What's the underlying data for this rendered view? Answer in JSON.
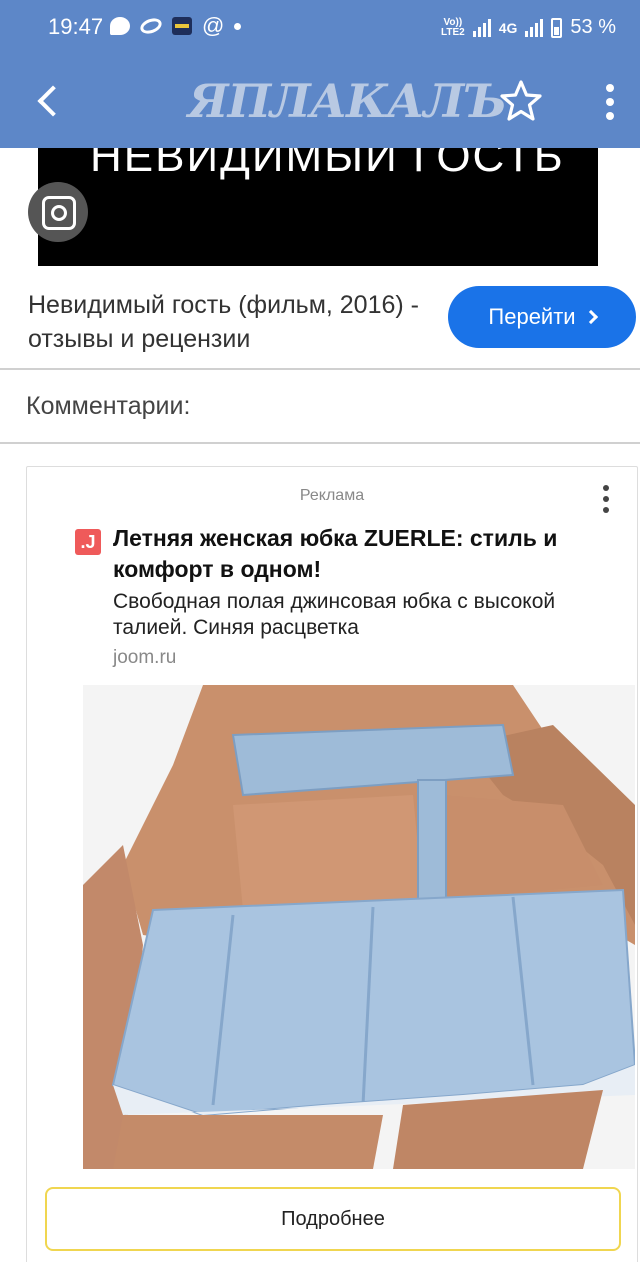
{
  "status_bar": {
    "time": "19:47",
    "network_top": "Vo))",
    "network_bottom": "LTE2",
    "network_type": "4G",
    "battery": "53 %"
  },
  "header": {
    "logo": "ЯПЛАКАЛЪ"
  },
  "top_banner": {
    "image_text": "НЕВИДИМЫЙ ГОСТЬ",
    "link_title": "Невидимый гость (фильм, 2016) - отзывы и рецензии",
    "go_button": "Перейти"
  },
  "comments": {
    "heading": "Комментарии:"
  },
  "ad": {
    "label": "Реклама",
    "favicon_letter": ".J",
    "title": "Летняя женская юбка ZUERLE: стиль и комфорт в одном!",
    "description": "Свободная полая джинсовая юбка с высокой талией. Синяя расцветка",
    "domain": "joom.ru",
    "button": "Подробнее"
  },
  "colors": {
    "header_bg": "#5d87c8",
    "go_button": "#1a73e8",
    "ad_button_border": "#f0d650",
    "favicon": "#ef5a5a"
  }
}
